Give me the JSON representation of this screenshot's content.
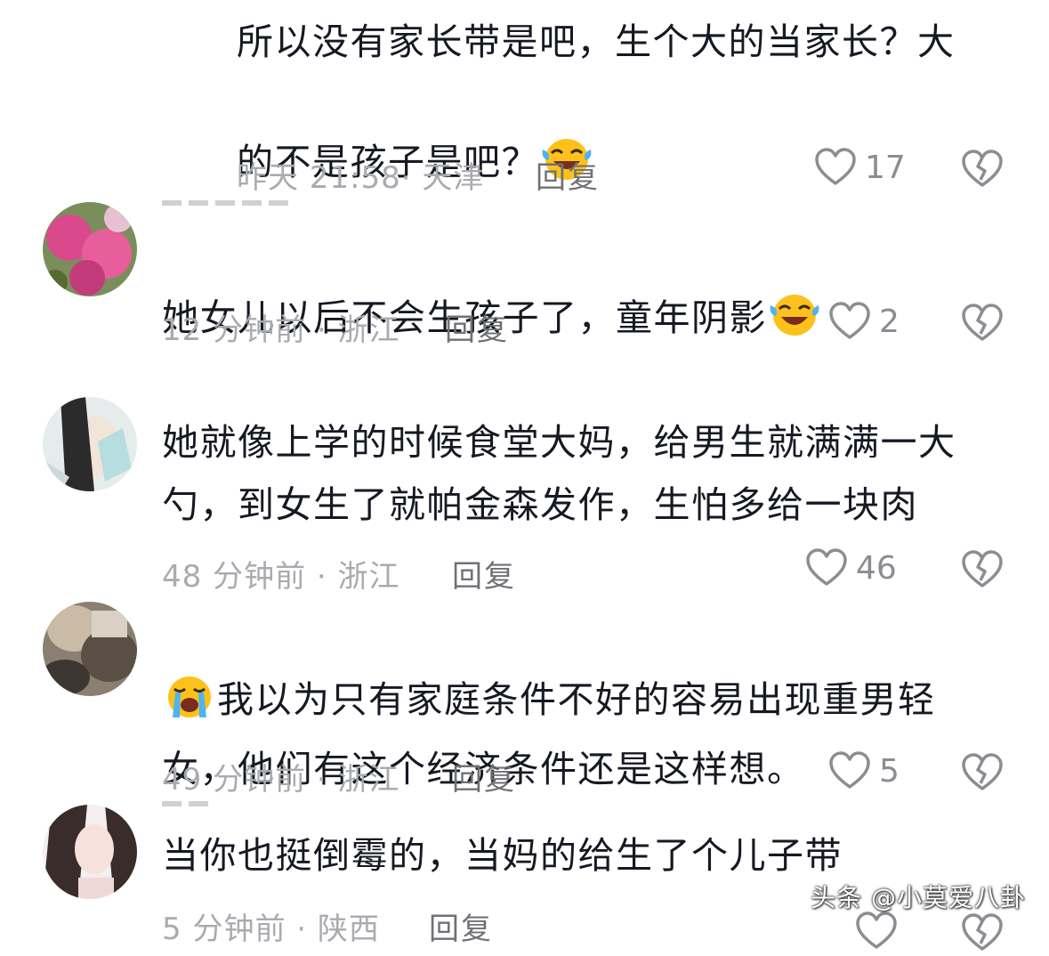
{
  "comments": [
    {
      "text": "所以没有家长带是吧，生个大的当家长？大\n的不是孩子是吧？",
      "emoji": "laugh-cry-emoji",
      "time": "昨天 21:58",
      "location": "天津",
      "reply_label": "回复",
      "likes": "17"
    },
    {
      "text": "她女儿以后不会生孩子了，童年阴影",
      "emoji": "laugh-cry-emoji",
      "time": "12 分钟前",
      "location": "浙江",
      "reply_label": "回复",
      "likes": "2"
    },
    {
      "text": "她就像上学的时候食堂大妈，给男生就满满一大\n勺，到女生了就帕金森发作，生怕多给一块肉",
      "time": "48 分钟前",
      "location": "浙江",
      "reply_label": "回复",
      "likes": "46"
    },
    {
      "text": "我以为只有家庭条件不好的容易出现重男轻\n女，他们有这个经济条件还是这样想。",
      "emoji": "loudly-crying-emoji",
      "time": "49 分钟前",
      "location": "浙江",
      "reply_label": "回复",
      "likes": "5"
    },
    {
      "text": "当你也挺倒霉的，当妈的给生了个儿子带",
      "time": "5 分钟前",
      "location": "陕西",
      "reply_label": "回复"
    }
  ],
  "watermark": "头条 @小莫爱八卦",
  "colors": {
    "text": "#161823",
    "meta": "#a9abb0",
    "reply": "#6f7176",
    "icon": "#8b8d92"
  }
}
